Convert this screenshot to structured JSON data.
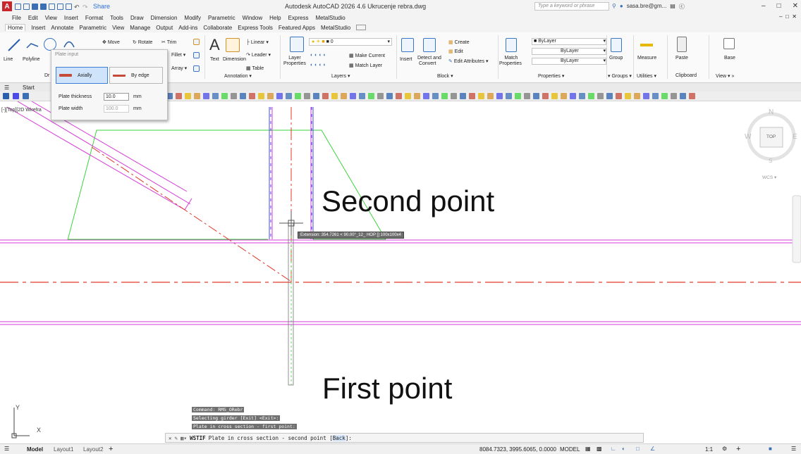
{
  "titlebar": {
    "logo_letter": "A",
    "share_label": "Share",
    "app_title": "Autodesk AutoCAD 2026  4.6 Ukrucenje rebra.dwg",
    "search_placeholder": "Type a keyword or phrase",
    "user_label": "sasa.bre@gm..."
  },
  "menu": [
    "File",
    "Edit",
    "View",
    "Insert",
    "Format",
    "Tools",
    "Draw",
    "Dimension",
    "Modify",
    "Parametric",
    "Window",
    "Help",
    "Express",
    "MetalStudio"
  ],
  "ribbon_tabs": [
    "Home",
    "Insert",
    "Annotate",
    "Parametric",
    "View",
    "Manage",
    "Output",
    "Add-ins",
    "Collaborate",
    "Express Tools",
    "Featured Apps",
    "MetalStudio"
  ],
  "ribbon": {
    "line": "Line",
    "polyline": "Polyline",
    "draw_panel_short": "Dr",
    "move": "Move",
    "rotate": "Rotate",
    "trim": "Trim",
    "fillet": "Fillet",
    "array": "Array",
    "text": "Text",
    "dimension": "Dimension",
    "linear": "Linear",
    "leader": "Leader",
    "table": "Table",
    "annotation_panel": "Annotation",
    "layer_properties": "Layer Properties",
    "layer_value": "0",
    "make_current": "Make Current",
    "match_layer": "Match Layer",
    "layers_panel": "Layers",
    "insert": "Insert",
    "detect_convert": "Detect and Convert",
    "create": "Create",
    "edit": "Edit",
    "edit_attributes": "Edit Attributes",
    "block_panel": "Block",
    "match_properties": "Match Properties",
    "bylayer_1": "ByLayer",
    "bylayer_2": "ByLayer",
    "bylayer_3": "ByLayer",
    "properties_panel": "Properties",
    "group": "Group",
    "groups_panel": "Groups",
    "measure": "Measure",
    "utilities_panel": "Utilities",
    "paste": "Paste",
    "clipboard_panel": "Clipboard",
    "base": "Base",
    "view_panel": "View"
  },
  "filetab": "Start",
  "viewport_label": "[-][Top][2D Wirefra",
  "plate_input": {
    "title": "Plate input",
    "axially": "Axially",
    "by_edge": "By edge",
    "thickness_label": "Plate thickness",
    "thickness_value": "10.0",
    "thickness_unit": "mm",
    "width_label": "Plate width",
    "width_value": "100.0",
    "width_unit": "mm"
  },
  "canvas": {
    "second_point": "Second point",
    "first_point": "First point",
    "tooltip": "Extension: 354.7261 < 90.00°_12_ HOP [] 100x100x4",
    "compass": {
      "n": "N",
      "s": "S",
      "e": "E",
      "w": "W",
      "top": "TOP",
      "wcs": "WCS"
    },
    "ucs_x": "X",
    "ucs_y": "Y"
  },
  "command_history": [
    "Command: RMS_ORebr",
    "Selecting girder [Exit] <Exit>:",
    "Plate in cross section - first point:"
  ],
  "command_line": {
    "cmd": "WSTIF",
    "prompt": "Plate in cross section - second point [",
    "option": "Back",
    "suffix": "]:"
  },
  "statusbar": {
    "layout_tabs": [
      "Model",
      "Layout1",
      "Layout2"
    ],
    "coords": "8084.7323, 3995.6065, 0.0000",
    "mode": "MODEL",
    "scale": "1:1"
  },
  "colors": {
    "magenta": "#d43bd8",
    "green": "#3bd43b",
    "red": "#e03a2a",
    "blue": "#4a4ae8",
    "accent": "#3b7fd4"
  }
}
